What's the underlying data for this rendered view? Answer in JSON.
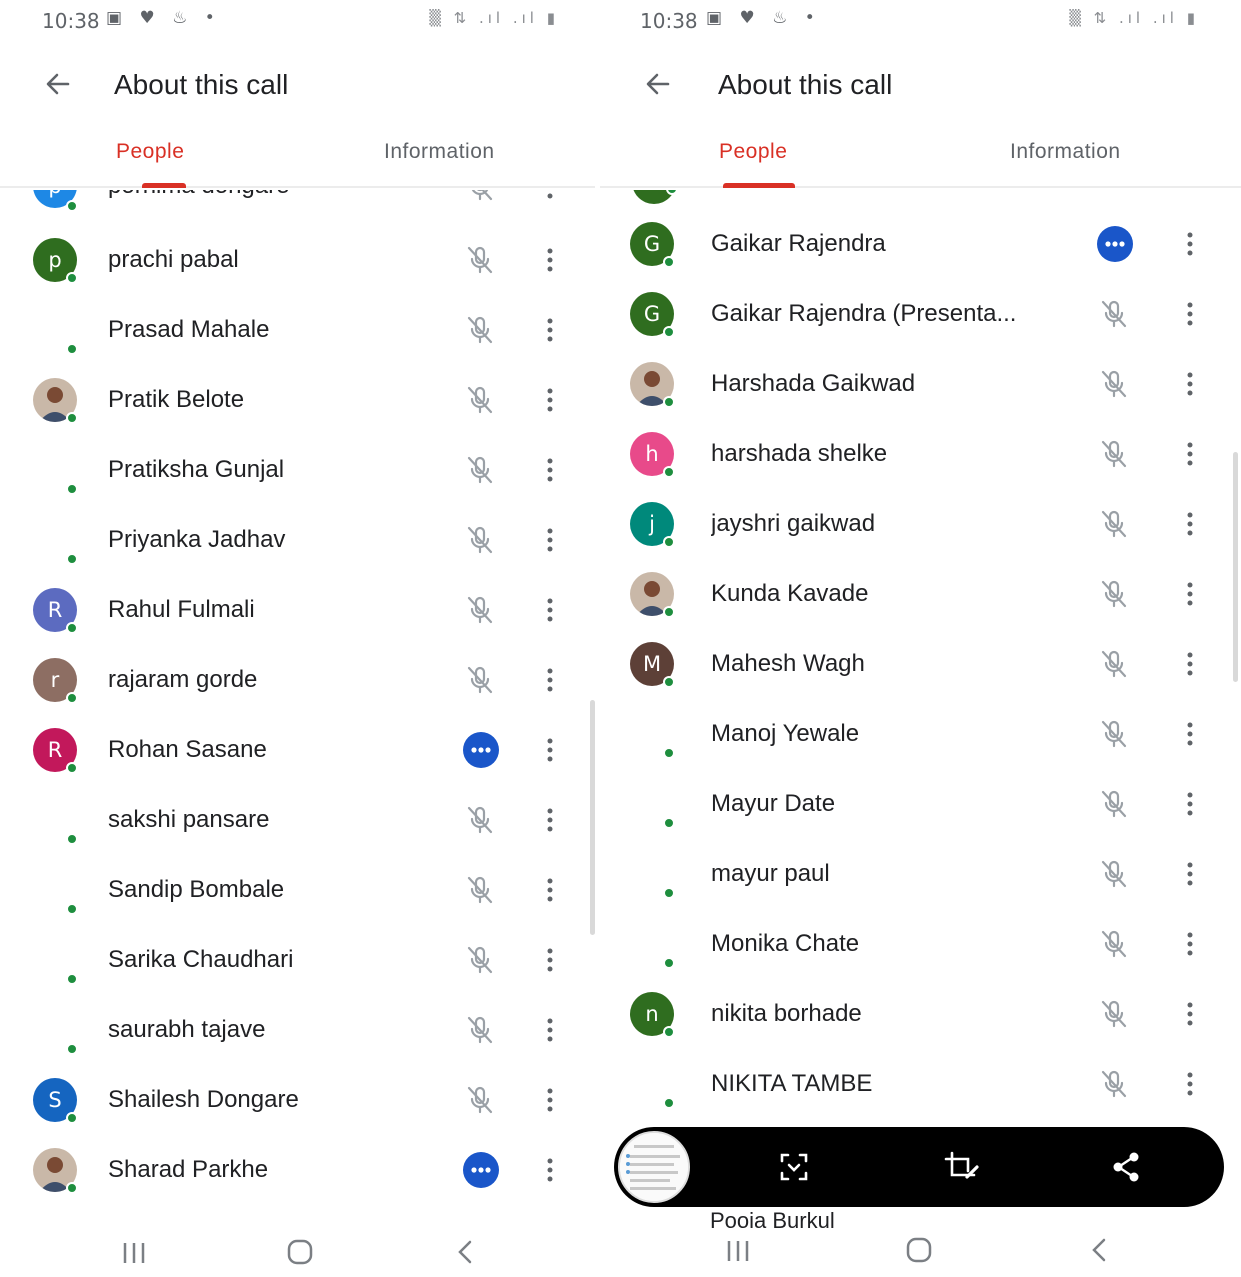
{
  "status_bar": {
    "time": "10:38"
  },
  "app_bar": {
    "title": "About this call"
  },
  "tabs": {
    "people": "People",
    "information": "Information"
  },
  "left_panel": {
    "partial_top_name": "pornima dongare",
    "participants": [
      {
        "name": "prachi pabal",
        "avatar_letter": "p",
        "avatar_color": "#2f6d1f",
        "status": "muted"
      },
      {
        "name": "Prasad Mahale",
        "avatar_letter": "",
        "avatar_color": "",
        "status": "muted"
      },
      {
        "name": "Pratik Belote",
        "avatar_letter": "",
        "avatar_color": "photo",
        "status": "muted"
      },
      {
        "name": "Pratiksha Gunjal",
        "avatar_letter": "",
        "avatar_color": "",
        "status": "muted"
      },
      {
        "name": "Priyanka Jadhav",
        "avatar_letter": "",
        "avatar_color": "",
        "status": "muted"
      },
      {
        "name": "Rahul Fulmali",
        "avatar_letter": "R",
        "avatar_color": "#5c6bc0",
        "status": "muted"
      },
      {
        "name": "rajaram gorde",
        "avatar_letter": "r",
        "avatar_color": "#8d6e63",
        "status": "muted"
      },
      {
        "name": "Rohan Sasane",
        "avatar_letter": "R",
        "avatar_color": "#c2185b",
        "status": "active"
      },
      {
        "name": "sakshi pansare",
        "avatar_letter": "",
        "avatar_color": "",
        "status": "muted"
      },
      {
        "name": "Sandip Bombale",
        "avatar_letter": "",
        "avatar_color": "",
        "status": "muted"
      },
      {
        "name": "Sarika Chaudhari",
        "avatar_letter": "",
        "avatar_color": "",
        "status": "muted"
      },
      {
        "name": "saurabh tajave",
        "avatar_letter": "",
        "avatar_color": "",
        "status": "muted"
      },
      {
        "name": "Shailesh Dongare",
        "avatar_letter": "S",
        "avatar_color": "#1565c0",
        "status": "muted"
      },
      {
        "name": "Sharad Parkhe",
        "avatar_letter": "",
        "avatar_color": "photo",
        "status": "active"
      }
    ]
  },
  "right_panel": {
    "participants": [
      {
        "name": "Gaikar Rajendra",
        "avatar_letter": "G",
        "avatar_color": "#2f6d1f",
        "status": "active"
      },
      {
        "name": "Gaikar Rajendra (Presenta...",
        "avatar_letter": "G",
        "avatar_color": "#2f6d1f",
        "status": "muted"
      },
      {
        "name": "Harshada Gaikwad",
        "avatar_letter": "",
        "avatar_color": "photo",
        "status": "muted"
      },
      {
        "name": "harshada shelke",
        "avatar_letter": "h",
        "avatar_color": "#e84a8a",
        "status": "muted"
      },
      {
        "name": "jayshri gaikwad",
        "avatar_letter": "j",
        "avatar_color": "#00897b",
        "status": "muted"
      },
      {
        "name": "Kunda Kavade",
        "avatar_letter": "",
        "avatar_color": "photo",
        "status": "muted"
      },
      {
        "name": "Mahesh Wagh",
        "avatar_letter": "M",
        "avatar_color": "#5d4037",
        "status": "muted"
      },
      {
        "name": "Manoj Yewale",
        "avatar_letter": "",
        "avatar_color": "",
        "status": "muted"
      },
      {
        "name": "Mayur Date",
        "avatar_letter": "",
        "avatar_color": "",
        "status": "muted"
      },
      {
        "name": "mayur paul",
        "avatar_letter": "",
        "avatar_color": "",
        "status": "muted"
      },
      {
        "name": "Monika Chate",
        "avatar_letter": "",
        "avatar_color": "",
        "status": "muted"
      },
      {
        "name": "nikita borhade",
        "avatar_letter": "n",
        "avatar_color": "#2f6d1f",
        "status": "muted"
      },
      {
        "name": "NIKITA TAMBE",
        "avatar_letter": "",
        "avatar_color": "",
        "status": "muted"
      }
    ],
    "partial_bottom_name": "Pooja Burkul"
  },
  "icons": {
    "back": "arrow-left-icon",
    "mic_off": "mic-off-icon",
    "more": "more-vert-icon",
    "speaking": "speaking-indicator-icon",
    "nav_recents": "recents-icon",
    "nav_home": "home-icon",
    "nav_back": "nav-back-icon",
    "shot_scroll": "scroll-capture-icon",
    "shot_edit": "crop-edit-icon",
    "shot_share": "share-icon"
  },
  "colors": {
    "accent": "#d93025",
    "presence": "#1e8e3e",
    "speaking": "#1a56c9"
  }
}
